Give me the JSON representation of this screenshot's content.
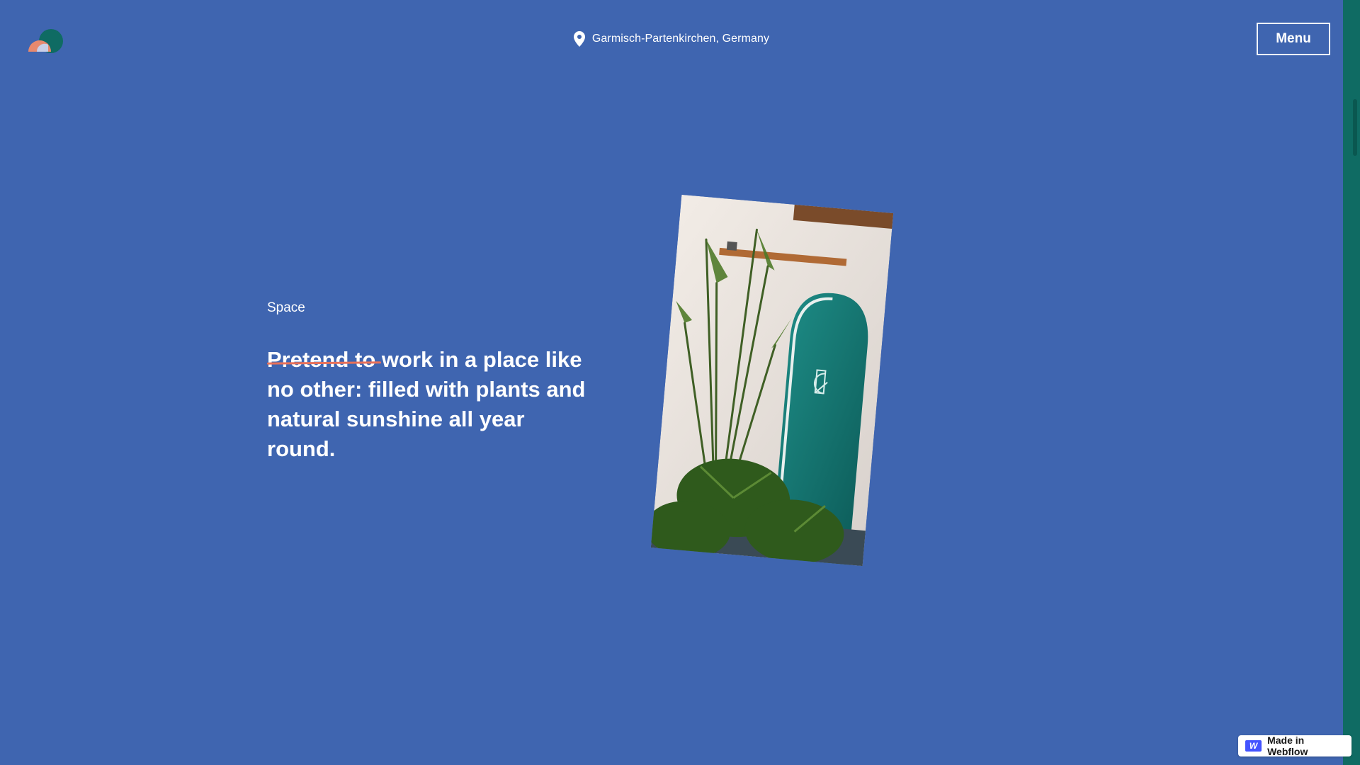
{
  "header": {
    "location": "Garmisch-Partenkirchen, Germany",
    "menu_label": "Menu"
  },
  "section": {
    "label": "Space",
    "headline_struck": "Pretend to",
    "headline_rest": " work in a place like no other: filled with plants and natural sunshine all year round."
  },
  "badge": {
    "label": "Made in Webflow",
    "icon_text": "W"
  },
  "colors": {
    "background": "#3f65b0",
    "accent_teal": "#0f6b63",
    "strike": "#e8715a"
  },
  "icons": [
    "logo-icon",
    "location-pin-icon",
    "webflow-icon"
  ]
}
